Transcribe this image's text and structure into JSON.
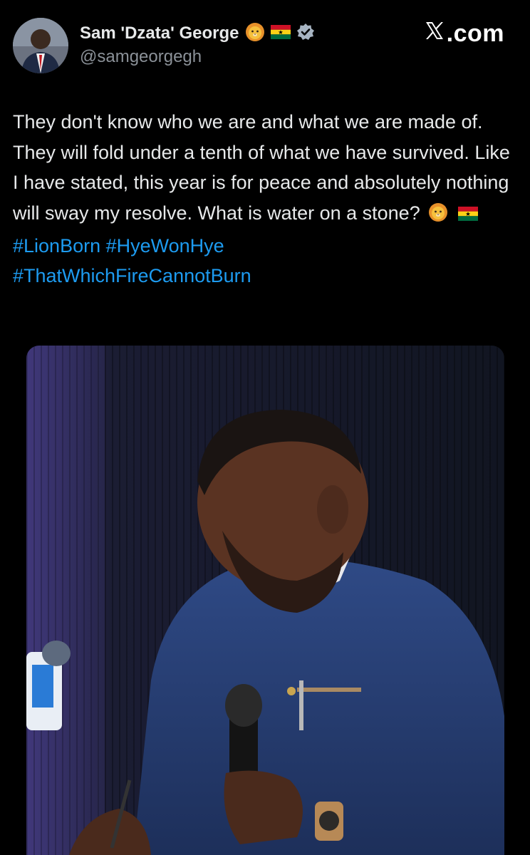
{
  "header": {
    "author_name": "Sam 'Dzata' George",
    "handle": "@samgeorgegh",
    "site_label": ".com",
    "site_x": "X",
    "avatar_icon": "avatar",
    "name_emojis": [
      "lion-face-emoji",
      "ghana-flag-emoji"
    ],
    "verified_icon": "verified-badge-icon"
  },
  "tweet": {
    "body": "They don't know who we are and what we are made of. They will fold under a tenth of what we have survived. Like I have stated, this year is for peace and absolutely nothing will sway my resolve. What is water on a stone?",
    "hashtags_line1": [
      "#LionBorn",
      "#HyeWonHye"
    ],
    "hashtags_line2": [
      "#ThatWhichFireCannotBurn"
    ],
    "trailing_emojis": [
      "lion-face-emoji",
      "ghana-flag-emoji"
    ]
  },
  "media": {
    "kind": "photo",
    "subject": "man-in-blue-suit-holding-microphone"
  },
  "colors": {
    "background": "#000000",
    "text": "#e7e9ea",
    "secondary_text": "#8b9198",
    "link": "#1d9bf0",
    "verified": "#a7b4c2"
  }
}
